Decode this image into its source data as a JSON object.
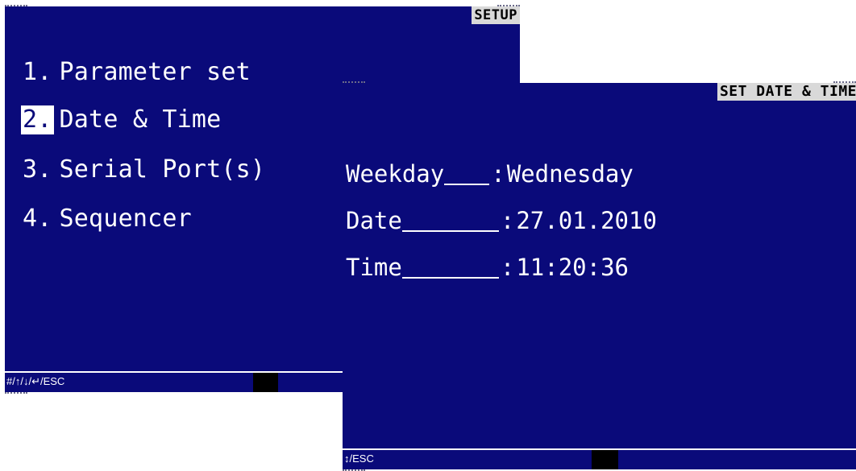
{
  "setup_screen": {
    "title": "SETUP",
    "menu": [
      {
        "number": "1.",
        "label": "Parameter set",
        "selected": false
      },
      {
        "number": "2.",
        "label": "Date & Time",
        "selected": true
      },
      {
        "number": "3.",
        "label": "Serial Port(s)",
        "selected": false
      },
      {
        "number": "4.",
        "label": "Sequencer",
        "selected": false
      }
    ],
    "footer_hint": "#/↑/↓/↵/ESC"
  },
  "datetime_screen": {
    "title": "SET DATE & TIME",
    "fields": [
      {
        "label": "Weekday",
        "value": "Wednesday"
      },
      {
        "label": "Date",
        "value": "27.01.2010"
      },
      {
        "label": "Time",
        "value": "11:20:36"
      }
    ],
    "footer_hint": "↕/ESC"
  },
  "colors": {
    "screen_background": "#0a0a7a",
    "text": "#ffffff",
    "title_background": "#d9d9d9"
  }
}
